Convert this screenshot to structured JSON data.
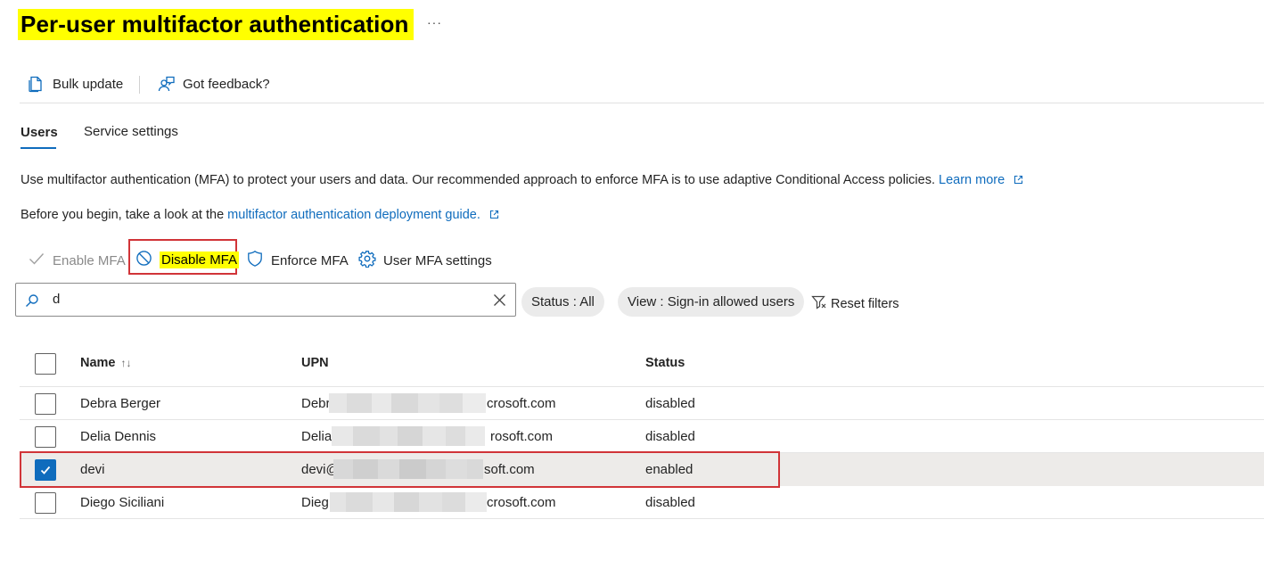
{
  "page": {
    "title": "Per-user multifactor authentication",
    "more": "···"
  },
  "commandbar": {
    "bulk_update": "Bulk update",
    "feedback": "Got feedback?"
  },
  "tabs": [
    {
      "label": "Users",
      "active": true
    },
    {
      "label": "Service settings",
      "active": false
    }
  ],
  "info": {
    "line1": "Use multifactor authentication (MFA) to protect your users and data. Our recommended approach to enforce MFA is to use adaptive Conditional Access policies.",
    "learn_more": "Learn more",
    "line2_prefix": "Before you begin, take a look at the",
    "guide_link": "multifactor authentication deployment guide."
  },
  "actions": {
    "enable": "Enable MFA",
    "disable": "Disable MFA",
    "enforce": "Enforce MFA",
    "settings": "User MFA settings"
  },
  "search": {
    "value": "d"
  },
  "filters": {
    "status": "Status : All",
    "view": "View : Sign-in allowed users",
    "reset": "Reset filters"
  },
  "table": {
    "headers": {
      "name": "Name",
      "sort": "↑↓",
      "upn": "UPN",
      "status": "Status"
    },
    "rows": [
      {
        "name": "Debra Berger",
        "upn_start": "Debr",
        "upn_end": "crosoft.com",
        "status": "disabled",
        "checked": false
      },
      {
        "name": "Delia Dennis",
        "upn_start": "Delia",
        "upn_end": "rosoft.com",
        "status": "disabled",
        "checked": false
      },
      {
        "name": "devi",
        "upn_start": "devi@",
        "upn_end": "soft.com",
        "status": "enabled",
        "checked": true
      },
      {
        "name": "Diego Siciliani",
        "upn_start": "Dieg",
        "upn_end": "crosoft.com",
        "status": "disabled",
        "checked": false
      }
    ]
  },
  "colors": {
    "accent": "#0f6cbd",
    "highlight": "#ffff00",
    "annotation": "#d13438"
  }
}
